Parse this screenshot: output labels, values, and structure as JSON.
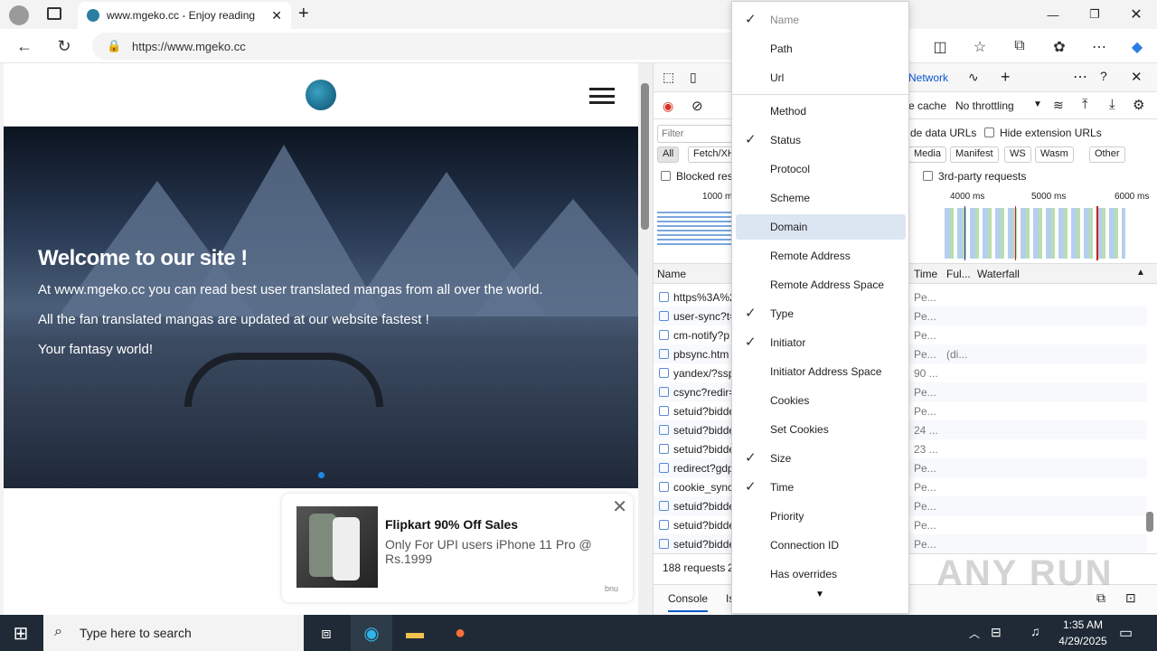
{
  "browser": {
    "tab_title": "www.mgeko.cc - Enjoy reading",
    "url": "https://www.mgeko.cc"
  },
  "site": {
    "hero_title": "Welcome to our site !",
    "hero_line1": "At www.mgeko.cc you can read best user translated mangas from all over the world.",
    "hero_line2": "All the fan translated mangas are updated at our website fastest !",
    "hero_line3": "Your fantasy world!"
  },
  "ad": {
    "title": "Flipkart 90% Off Sales",
    "subtitle": "Only For UPI users iPhone 11 Pro @ Rs.1999",
    "brand": "bnu"
  },
  "devtools": {
    "tab_network": "Network",
    "disable_cache": "e cache",
    "throttling": "No throttling",
    "filter_placeholder": "Filter",
    "hide_data_urls": "de data URLs",
    "hide_ext_urls": "Hide extension URLs",
    "chips": [
      "All",
      "Fetch/XH",
      "Media",
      "Manifest",
      "WS",
      "Wasm",
      "Other"
    ],
    "blocked": "Blocked res",
    "third_party": "3rd-party requests",
    "overview_ticks": [
      "1000 m",
      "4000 ms",
      "5000 ms",
      "6000 ms"
    ],
    "col_name": "Name",
    "col_time": "Time",
    "col_full": "Ful...",
    "col_waterfall": "Waterfall",
    "rows": [
      {
        "name": "https%3A%2",
        "time": "Pe...",
        "full": ""
      },
      {
        "name": "user-sync?t=",
        "time": "Pe...",
        "full": ""
      },
      {
        "name": "cm-notify?p",
        "time": "Pe...",
        "full": ""
      },
      {
        "name": "pbsync.htm",
        "time": "Pe...",
        "full": "(di..."
      },
      {
        "name": "yandex/?ssp",
        "time": "90 ...",
        "full": ""
      },
      {
        "name": "csync?redir=",
        "time": "Pe...",
        "full": ""
      },
      {
        "name": "setuid?bidde",
        "time": "Pe...",
        "full": ""
      },
      {
        "name": "setuid?bidde",
        "time": "24 ...",
        "full": ""
      },
      {
        "name": "setuid?bidde",
        "time": "23 ...",
        "full": ""
      },
      {
        "name": "redirect?gdp",
        "time": "Pe...",
        "full": ""
      },
      {
        "name": "cookie_sync",
        "time": "Pe...",
        "full": ""
      },
      {
        "name": "setuid?bidde",
        "time": "Pe...",
        "full": ""
      },
      {
        "name": "setuid?bidde",
        "time": "Pe...",
        "full": ""
      },
      {
        "name": "setuid?bidde",
        "time": "Pe...",
        "full": ""
      }
    ],
    "requests": "188 requests",
    "requests_tail": "2",
    "drawer_console": "Console",
    "drawer_issues": "Is"
  },
  "menu": {
    "items": [
      {
        "label": "Name",
        "checked": true,
        "dim": true
      },
      {
        "label": "Path",
        "checked": false
      },
      {
        "label": "Url",
        "checked": false
      },
      {
        "label": "Method",
        "checked": false
      },
      {
        "label": "Status",
        "checked": true
      },
      {
        "label": "Protocol",
        "checked": false
      },
      {
        "label": "Scheme",
        "checked": false
      },
      {
        "label": "Domain",
        "checked": false,
        "highlight": true
      },
      {
        "label": "Remote Address",
        "checked": false
      },
      {
        "label": "Remote Address Space",
        "checked": false
      },
      {
        "label": "Type",
        "checked": true
      },
      {
        "label": "Initiator",
        "checked": true
      },
      {
        "label": "Initiator Address Space",
        "checked": false
      },
      {
        "label": "Cookies",
        "checked": false
      },
      {
        "label": "Set Cookies",
        "checked": false
      },
      {
        "label": "Size",
        "checked": true
      },
      {
        "label": "Time",
        "checked": true
      },
      {
        "label": "Priority",
        "checked": false
      },
      {
        "label": "Connection ID",
        "checked": false
      },
      {
        "label": "Has overrides",
        "checked": false
      }
    ]
  },
  "taskbar": {
    "search_placeholder": "Type here to search",
    "time": "1:35 AM",
    "date": "4/29/2025"
  },
  "watermark": "ANY RUN"
}
